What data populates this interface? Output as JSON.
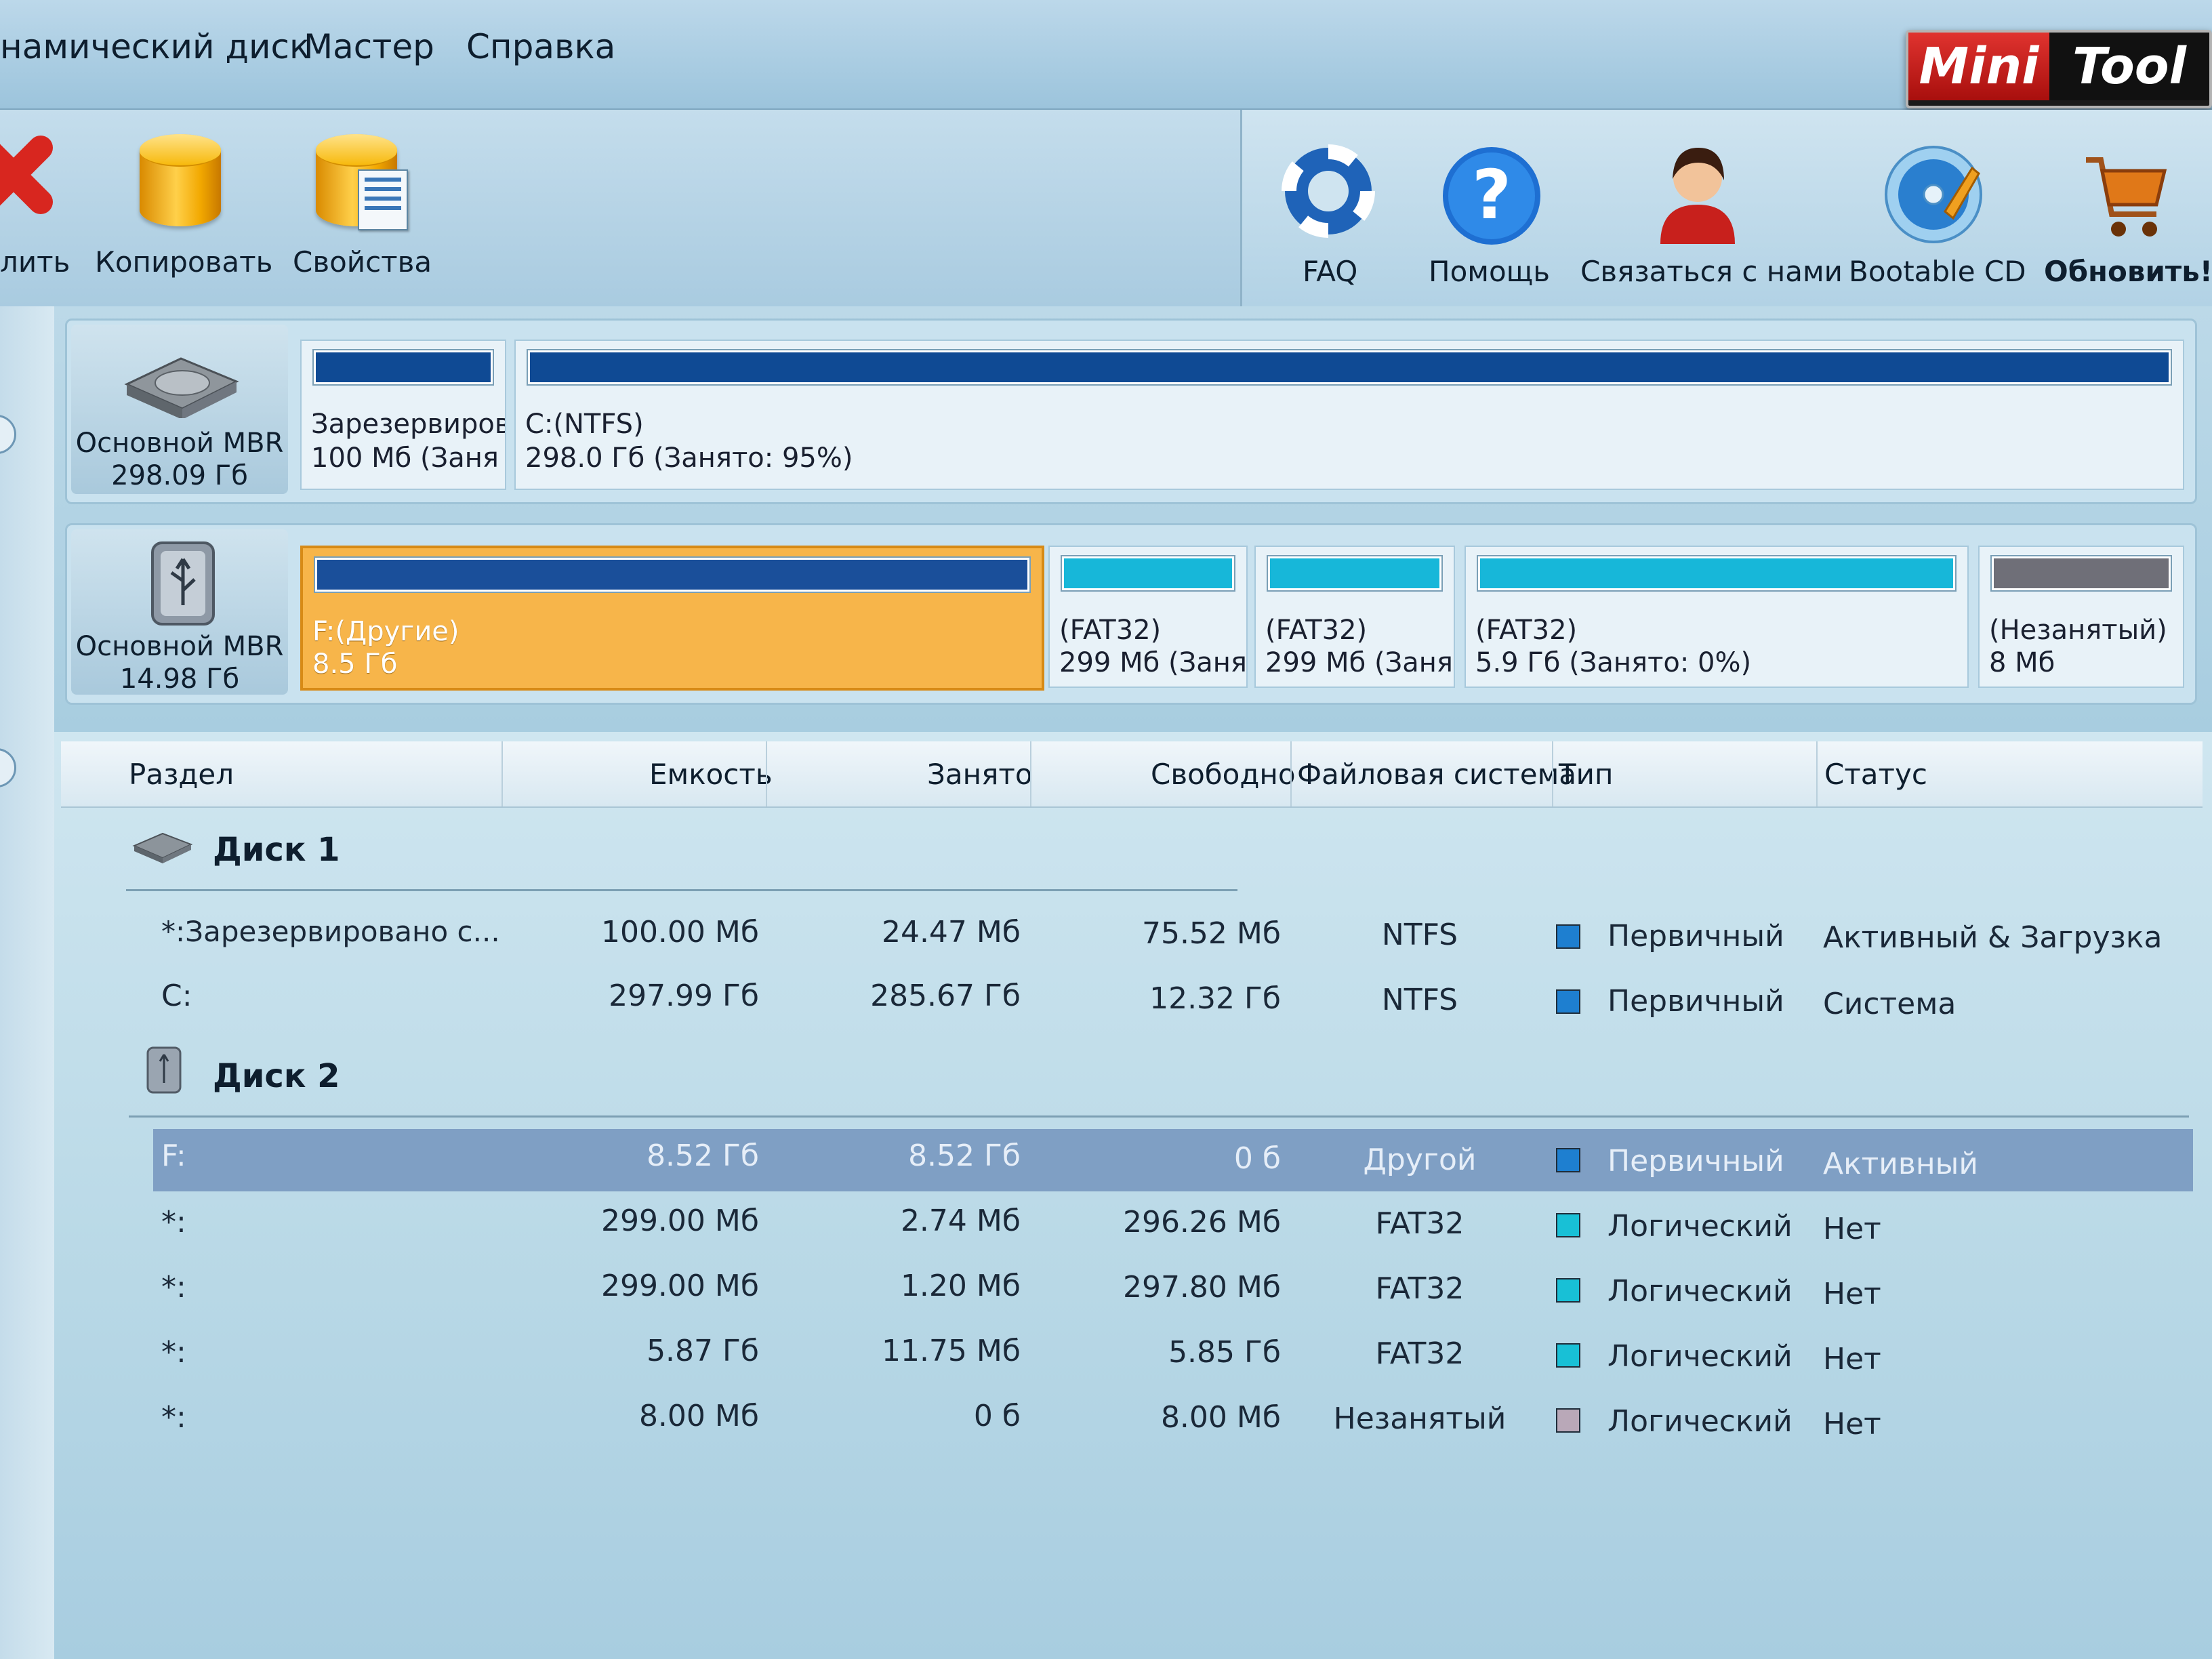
{
  "menu": {
    "items": [
      "намический диск",
      "Мастер",
      "Справка"
    ]
  },
  "logo": {
    "mini": "Mini",
    "tool": "Tool"
  },
  "toolbar": {
    "left": [
      {
        "label": "лить",
        "icon": "delete-icon"
      },
      {
        "label": "Копировать",
        "icon": "copy-disk-icon"
      },
      {
        "label": "Свойства",
        "icon": "properties-icon"
      }
    ],
    "right": [
      {
        "label": "FAQ",
        "icon": "lifebuoy-icon"
      },
      {
        "label": "Помощь",
        "icon": "help-icon"
      },
      {
        "label": "Связаться с нами",
        "icon": "contact-icon"
      },
      {
        "label": "Bootable CD",
        "icon": "bootable-cd-icon"
      },
      {
        "label": "Обновить!",
        "icon": "upgrade-cart-icon"
      }
    ]
  },
  "diskmap": {
    "disk1": {
      "type": "Основной MBR",
      "size": "298.09 Гб",
      "icon": "hard-disk-icon",
      "partitions": [
        {
          "line1": "Зарезервиров",
          "line2": "100 Мб (Заня",
          "bar": "ntfs"
        },
        {
          "line1": "C:(NTFS)",
          "line2": "298.0 Гб (Занято: 95%)",
          "bar": "ntfs",
          "used_fraction": 0.95
        }
      ]
    },
    "disk2": {
      "type": "Основной MBR",
      "size": "14.98 Гб",
      "icon": "usb-drive-icon",
      "partitions": [
        {
          "line1": "F:(Другие)",
          "line2": "8.5 Гб",
          "bar": "other",
          "selected": true
        },
        {
          "line1": "(FAT32)",
          "line2": "299 Мб (Заня",
          "bar": "fat"
        },
        {
          "line1": "(FAT32)",
          "line2": "299 Мб (Заня",
          "bar": "fat"
        },
        {
          "line1": "(FAT32)",
          "line2": "5.9 Гб (Занято: 0%)",
          "bar": "fat",
          "used_fraction": 0.0
        },
        {
          "line1": "(Незанятый)",
          "line2": "8 Мб",
          "bar": "free"
        }
      ]
    }
  },
  "table": {
    "headers": [
      "Раздел",
      "Емкость",
      "Занято",
      "Свободно",
      "Файловая система",
      "Тип",
      "Статус"
    ],
    "groups": [
      {
        "title": "Диск 1",
        "icon": "hard-disk-icon",
        "rows": [
          {
            "name": "*:Зарезервировано с...",
            "capacity": "100.00 Мб",
            "used": "24.47 Мб",
            "free": "75.52 Мб",
            "fs": "NTFS",
            "type": "Первичный",
            "status": "Активный & Загрузка",
            "color": "#1e7fd0"
          },
          {
            "name": "C:",
            "capacity": "297.99 Гб",
            "used": "285.67 Гб",
            "free": "12.32 Гб",
            "fs": "NTFS",
            "type": "Первичный",
            "status": "Система",
            "color": "#1e7fd0"
          }
        ]
      },
      {
        "title": "Диск 2",
        "icon": "usb-drive-icon",
        "rows": [
          {
            "name": "F:",
            "capacity": "8.52 Гб",
            "used": "8.52 Гб",
            "free": "0 б",
            "fs": "Другой",
            "type": "Первичный",
            "status": "Активный",
            "color": "#1e7fd0",
            "selected": true
          },
          {
            "name": "*:",
            "capacity": "299.00 Мб",
            "used": "2.74 Мб",
            "free": "296.26 Мб",
            "fs": "FAT32",
            "type": "Логический",
            "status": "Нет",
            "color": "#18c0d6"
          },
          {
            "name": "*:",
            "capacity": "299.00 Мб",
            "used": "1.20 Мб",
            "free": "297.80 Мб",
            "fs": "FAT32",
            "type": "Логический",
            "status": "Нет",
            "color": "#18c0d6"
          },
          {
            "name": "*:",
            "capacity": "5.87 Гб",
            "used": "11.75 Мб",
            "free": "5.85 Гб",
            "fs": "FAT32",
            "type": "Логический",
            "status": "Нет",
            "color": "#18c0d6"
          },
          {
            "name": "*:",
            "capacity": "8.00 Мб",
            "used": "0 б",
            "free": "8.00 Мб",
            "fs": "Незанятый",
            "type": "Логический",
            "status": "Нет",
            "color": "#b9a8b8"
          }
        ]
      }
    ]
  }
}
